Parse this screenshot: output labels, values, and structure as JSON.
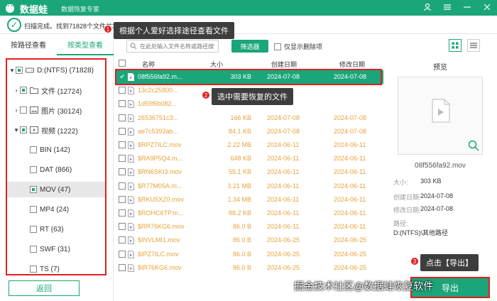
{
  "app": {
    "title": "数据蛙",
    "subtitle": "数据恢复专家",
    "brand_color": "#1aa57a",
    "highlight_color": "#e02020"
  },
  "window_controls": [
    "person-icon",
    "menu-icon",
    "minimize-icon",
    "close-icon"
  ],
  "status": {
    "text": "扫描完成。找到71828个文件共31.20"
  },
  "callouts": [
    {
      "num": "1",
      "text": "根据个人爱好选择途径查看文件"
    },
    {
      "num": "2",
      "text": "选中需要恢复的文件"
    },
    {
      "num": "3",
      "text": "点击【导出】"
    }
  ],
  "left_tabs": [
    {
      "label": "按路径查看",
      "active": false
    },
    {
      "label": "按类型查看",
      "active": true
    }
  ],
  "tree": [
    {
      "label": "D:(NTFS) (71828)",
      "level": 0,
      "chevron": "▾",
      "check": "part",
      "icon": "drive-icon"
    },
    {
      "label": "文件 (12724)",
      "level": 1,
      "chevron": "›",
      "check": "part",
      "icon": "folder-icon"
    },
    {
      "label": "图片 (30124)",
      "level": 1,
      "chevron": "›",
      "check": "none",
      "icon": "image-icon"
    },
    {
      "label": "视频 (1222)",
      "level": 1,
      "chevron": "▾",
      "check": "part",
      "icon": "video-icon"
    },
    {
      "label": "BIN (142)",
      "level": 2,
      "chevron": "",
      "check": "none",
      "icon": ""
    },
    {
      "label": "DAT (866)",
      "level": 2,
      "chevron": "",
      "check": "none",
      "icon": ""
    },
    {
      "label": "MOV (47)",
      "level": 2,
      "chevron": "",
      "check": "part",
      "icon": "",
      "selected": true
    },
    {
      "label": "MP4 (24)",
      "level": 2,
      "chevron": "",
      "check": "none",
      "icon": ""
    },
    {
      "label": "RT (63)",
      "level": 2,
      "chevron": "",
      "check": "none",
      "icon": ""
    },
    {
      "label": "SWF (31)",
      "level": 2,
      "chevron": "",
      "check": "none",
      "icon": ""
    },
    {
      "label": "TS (7)",
      "level": 2,
      "chevron": "",
      "check": "none",
      "icon": ""
    }
  ],
  "back_button": "返回",
  "toolbar": {
    "search_placeholder": "在此处输入文件名称或路径搜索",
    "filter_label": "筛选器",
    "only_deleted_label": "仅显示删除项"
  },
  "table": {
    "headers": [
      "名称",
      "大小",
      "创建日期",
      "修改日期"
    ],
    "rows": [
      {
        "name": "08f556fa92.m...",
        "size": "303 KB",
        "created": "2024-07-08",
        "modified": "2024-07-08",
        "selected": true
      },
      {
        "name": "13c2c25800...",
        "size": "",
        "created": "",
        "modified": ""
      },
      {
        "name": "1d59f6b082...",
        "size": "",
        "created": "",
        "modified": ""
      },
      {
        "name": "26536751c3...",
        "size": "166 KB",
        "created": "2024-07-08",
        "modified": "2024-07-08"
      },
      {
        "name": "ae7c5393ab...",
        "size": "84.1 KB",
        "created": "2024-07-08",
        "modified": "2024-07-08"
      },
      {
        "name": "$RPZ7ILC.mov",
        "size": "2.22 MB",
        "created": "2024-06-11",
        "modified": "2024-06-11"
      },
      {
        "name": "$RA9P5Q4.m...",
        "size": "648 KB",
        "created": "2024-06-11",
        "modified": "2024-06-11"
      },
      {
        "name": "$RN6SKI3.mov",
        "size": "55.1 KB",
        "created": "2024-06-11",
        "modified": "2024-06-11"
      },
      {
        "name": "$R77M05A.m...",
        "size": "3.21 MB",
        "created": "2024-06-11",
        "modified": "2024-06-11"
      },
      {
        "name": "$RKU5XZ0.mov",
        "size": "1.34 MB",
        "created": "2024-06-11",
        "modified": "2024-06-11"
      },
      {
        "name": "$ROHC6TP.m...",
        "size": "88.2 KB",
        "created": "2024-06-11",
        "modified": "2024-06-11"
      },
      {
        "name": "$RR76KG6.mov",
        "size": "86.0 B",
        "created": "2024-06-11",
        "modified": "2024-06-11"
      },
      {
        "name": "$INVLMI1.mov",
        "size": "86.0 B",
        "created": "2024-06-25",
        "modified": "2024-06-25"
      },
      {
        "name": "$IPZ7ILC.mov",
        "size": "86.0 B",
        "created": "2024-06-25",
        "modified": "2024-06-25"
      },
      {
        "name": "$IR76KG6.mov",
        "size": "86.0 B",
        "created": "2024-06-25",
        "modified": "2024-06-25"
      }
    ]
  },
  "preview": {
    "title": "预览",
    "file_name": "08f556fa92.mov",
    "info": [
      {
        "label": "大小:",
        "value": "303 KB"
      },
      {
        "label": "创建日期:",
        "value": "2024-07-08"
      },
      {
        "label": "修改日期:",
        "value": "2024-07-08"
      },
      {
        "label": "路径:",
        "value": ""
      }
    ],
    "path": "D:(NTFS)\\其他路径"
  },
  "export_button": "导出",
  "watermark": "掘金技术社区@数据蛙恢复软件"
}
